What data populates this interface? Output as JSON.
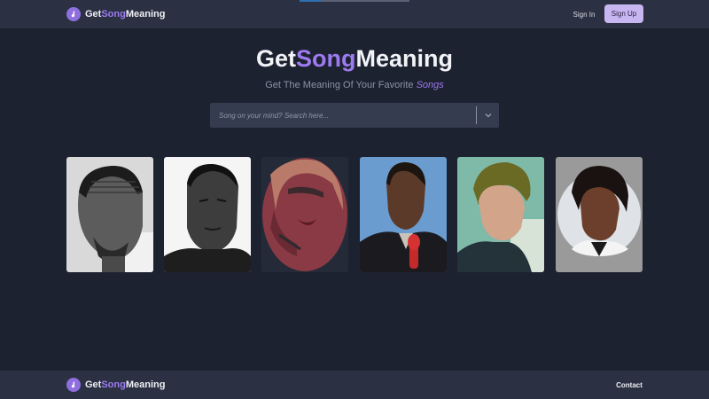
{
  "header": {
    "brand": {
      "prefix": "Get",
      "accent": "Song",
      "suffix": "Meaning"
    },
    "sign_in_label": "Sign In",
    "sign_up_label": "Sign Up"
  },
  "hero": {
    "title": {
      "prefix": "Get",
      "accent": "Song",
      "suffix": "Meaning"
    },
    "subtitle": {
      "text": "Get The Meaning Of Your Favorite",
      "accent": "Songs"
    }
  },
  "search": {
    "placeholder": "Song on your mind? Search here..."
  },
  "artists": [
    {
      "name": "artist-card-1",
      "style": "monochrome"
    },
    {
      "name": "artist-card-2",
      "style": "monochrome"
    },
    {
      "name": "artist-card-3",
      "style": "oval-portrait"
    },
    {
      "name": "artist-card-4",
      "style": "color"
    },
    {
      "name": "artist-card-5",
      "style": "color"
    },
    {
      "name": "artist-card-6",
      "style": "circle-portrait"
    }
  ],
  "footer": {
    "brand": {
      "prefix": "Get",
      "accent": "Song",
      "suffix": "Meaning"
    },
    "contact_label": "Contact"
  },
  "colors": {
    "background": "#1d2230",
    "bar": "#2b3142",
    "accent": "#9d7af0",
    "sign_up_bg": "#c8b6f2"
  },
  "icons": [
    "music-note-icon",
    "chevron-down-icon"
  ]
}
